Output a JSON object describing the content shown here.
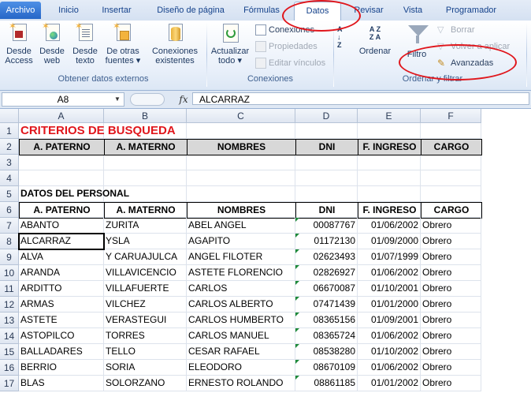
{
  "tabs": [
    {
      "label": "Archivo",
      "kind": "file"
    },
    {
      "label": "Inicio",
      "kind": "normal"
    },
    {
      "label": "Insertar",
      "kind": "normal"
    },
    {
      "label": "Diseño de página",
      "kind": "normal"
    },
    {
      "label": "Fórmulas",
      "kind": "normal"
    },
    {
      "label": "Datos",
      "kind": "active"
    },
    {
      "label": "Revisar",
      "kind": "normal"
    },
    {
      "label": "Vista",
      "kind": "normal"
    },
    {
      "label": "Programador",
      "kind": "normal"
    }
  ],
  "ribbon": {
    "get_external": {
      "label": "Obtener datos externos",
      "buttons": [
        {
          "line1": "Desde",
          "line2": "Access",
          "icon": "access-icon"
        },
        {
          "line1": "Desde",
          "line2": "web",
          "icon": "web-icon"
        },
        {
          "line1": "Desde",
          "line2": "texto",
          "icon": "text-file-icon"
        },
        {
          "line1": "De otras",
          "line2": "fuentes ▾",
          "icon": "other-sources-icon"
        },
        {
          "line1": "Conexiones",
          "line2": "existentes",
          "icon": "existing-connections-icon"
        }
      ]
    },
    "connections": {
      "label": "Conexiones",
      "refresh_line1": "Actualizar",
      "refresh_line2": "todo ▾",
      "small": [
        {
          "label": "Conexiones",
          "enabled": true
        },
        {
          "label": "Propiedades",
          "enabled": false
        },
        {
          "label": "Editar vínculos",
          "enabled": false
        }
      ]
    },
    "sort_filter": {
      "label": "Ordenar y filtrar",
      "sort_label": "Ordenar",
      "filter_label": "Filtro",
      "small": [
        {
          "label": "Borrar",
          "enabled": false
        },
        {
          "label": "Volver a aplicar",
          "enabled": false
        },
        {
          "label": "Avanzadas",
          "enabled": true
        }
      ]
    }
  },
  "formula_bar": {
    "name_box": "A8",
    "fx": "fx",
    "content": "ALCARRAZ"
  },
  "columns": [
    "A",
    "B",
    "C",
    "D",
    "E",
    "F"
  ],
  "rows": [
    "1",
    "2",
    "3",
    "4",
    "5",
    "6",
    "7",
    "8",
    "9",
    "10",
    "11",
    "12",
    "13",
    "14",
    "15",
    "16",
    "17"
  ],
  "sheet": {
    "criteria_title": "CRITERIOS DE BUSQUEDA",
    "criteria_headers": [
      "A. PATERNO",
      "A. MATERNO",
      "NOMBRES",
      "DNI",
      "F. INGRESO",
      "CARGO"
    ],
    "personal_title": "DATOS DEL PERSONAL",
    "personal_headers": [
      "A. PATERNO",
      "A. MATERNO",
      "NOMBRES",
      "DNI",
      "F. INGRESO",
      "CARGO"
    ],
    "records": [
      [
        "ABANTO",
        "ZURITA",
        "ABEL ANGEL",
        "00087767",
        "01/06/2002",
        "Obrero"
      ],
      [
        "ALCARRAZ",
        "YSLA",
        "AGAPITO",
        "01172130",
        "01/09/2000",
        "Obrero"
      ],
      [
        "ALVA",
        "Y CARUAJULCA",
        "ANGEL FILOTER",
        "02623493",
        "01/07/1999",
        "Obrero"
      ],
      [
        "ARANDA",
        "VILLAVICENCIO",
        "ASTETE FLORENCIO",
        "02826927",
        "01/06/2002",
        "Obrero"
      ],
      [
        "ARDITTO",
        "VILLAFUERTE",
        "CARLOS",
        "06670087",
        "01/10/2001",
        "Obrero"
      ],
      [
        "ARMAS",
        "VILCHEZ",
        "CARLOS ALBERTO",
        "07471439",
        "01/01/2000",
        "Obrero"
      ],
      [
        "ASTETE",
        "VERASTEGUI",
        "CARLOS HUMBERTO",
        "08365156",
        "01/09/2001",
        "Obrero"
      ],
      [
        "ASTOPILCO",
        "TORRES",
        "CARLOS MANUEL",
        "08365724",
        "01/06/2002",
        "Obrero"
      ],
      [
        "BALLADARES",
        "TELLO",
        "CESAR RAFAEL",
        "08538280",
        "01/10/2002",
        "Obrero"
      ],
      [
        "BERRIO",
        "SORIA",
        "ELEODORO",
        "08670109",
        "01/06/2002",
        "Obrero"
      ],
      [
        "BLAS",
        "SOLORZANO",
        "ERNESTO ROLANDO",
        "08861185",
        "01/01/2002",
        "Obrero"
      ]
    ]
  }
}
